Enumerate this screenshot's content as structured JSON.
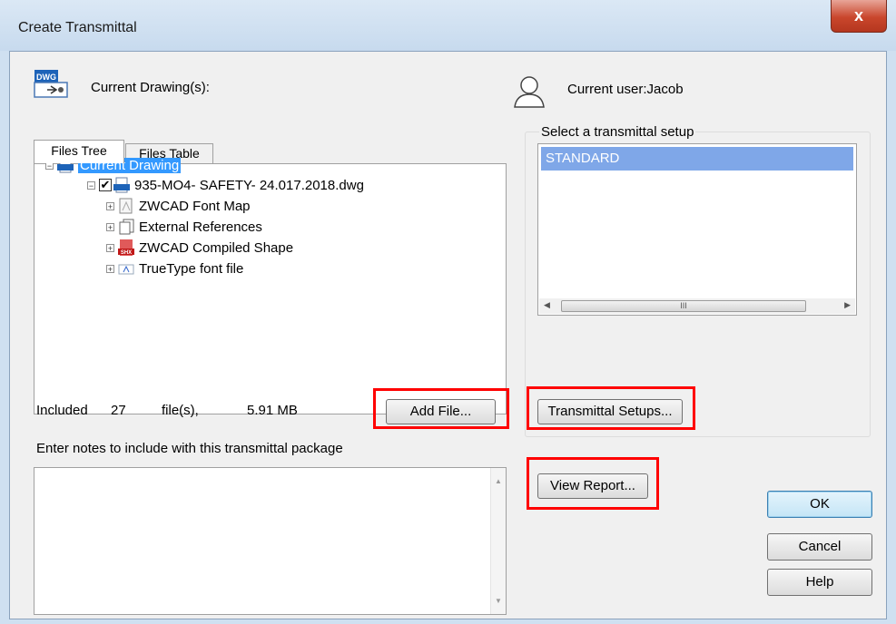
{
  "window": {
    "title": "Create Transmittal",
    "close_glyph": "x"
  },
  "left": {
    "drawing_icon_text": "DWG",
    "current_drawings_label": "Current Drawing(s):",
    "tabs": [
      {
        "label": "Files Tree"
      },
      {
        "label": "Files Table"
      }
    ],
    "tree": [
      {
        "label": "Current Drawing",
        "icon": "dwg-icon",
        "expander": "−",
        "selected": true
      },
      {
        "label": "935-MO4- SAFETY- 24.017.2018.dwg",
        "icon": "dwg-icon",
        "expander": "−",
        "checked": true
      },
      {
        "label": "ZWCAD Font Map",
        "icon": "font-map-icon",
        "expander": "+"
      },
      {
        "label": "External References",
        "icon": "external-references-icon",
        "expander": "+"
      },
      {
        "label": "ZWCAD Compiled Shape",
        "icon": "shx-icon",
        "icon_text": "SHX",
        "expander": "+"
      },
      {
        "label": "TrueType font file",
        "icon": "truetype-font-icon",
        "expander": "+"
      }
    ],
    "included_label": "Included",
    "included_count": "27",
    "files_label": "file(s),",
    "total_size": "5.91 MB",
    "add_file_label": "Add File...",
    "notes_label": "Enter notes to include with this transmittal package",
    "notes_value": ""
  },
  "right": {
    "current_user_label": "Current user:Jacob",
    "setup_label": "Select a transmittal setup",
    "setups": [
      {
        "label": "STANDARD",
        "selected": true
      }
    ],
    "scroll_thumb_glyph": "III",
    "transmittal_setups_label": "Transmittal Setups...",
    "view_report_label": "View Report..."
  },
  "buttons": {
    "ok": "OK",
    "cancel": "Cancel",
    "help": "Help"
  },
  "colors": {
    "highlight_box": "#ff0000",
    "selection": "#3399ff",
    "list_selection": "#7fa7e8"
  }
}
